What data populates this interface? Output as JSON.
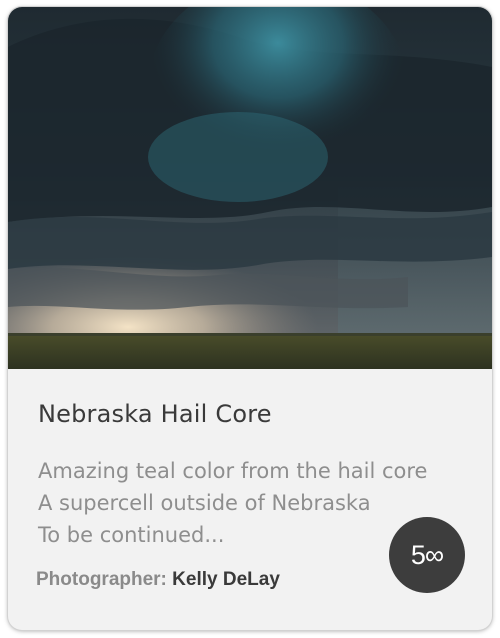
{
  "photo": {
    "alt": "Nebraska Hail Core"
  },
  "card": {
    "title": "Nebraska Hail Core",
    "description": [
      "Amazing teal color from the hail core",
      "A supercell outside of Nebraska",
      "To be continued..."
    ],
    "credit_label": "Photographer:",
    "photographer": "Kelly DeLay"
  },
  "badge": {
    "text": "5∞",
    "icon": "500px-logo-icon",
    "color": "#3d3d3d"
  },
  "colors": {
    "card_bg": "#f2f2f2",
    "title": "#3a3a3a",
    "description": "#8e8e8e",
    "storm_teal": "#2f6e7c"
  }
}
